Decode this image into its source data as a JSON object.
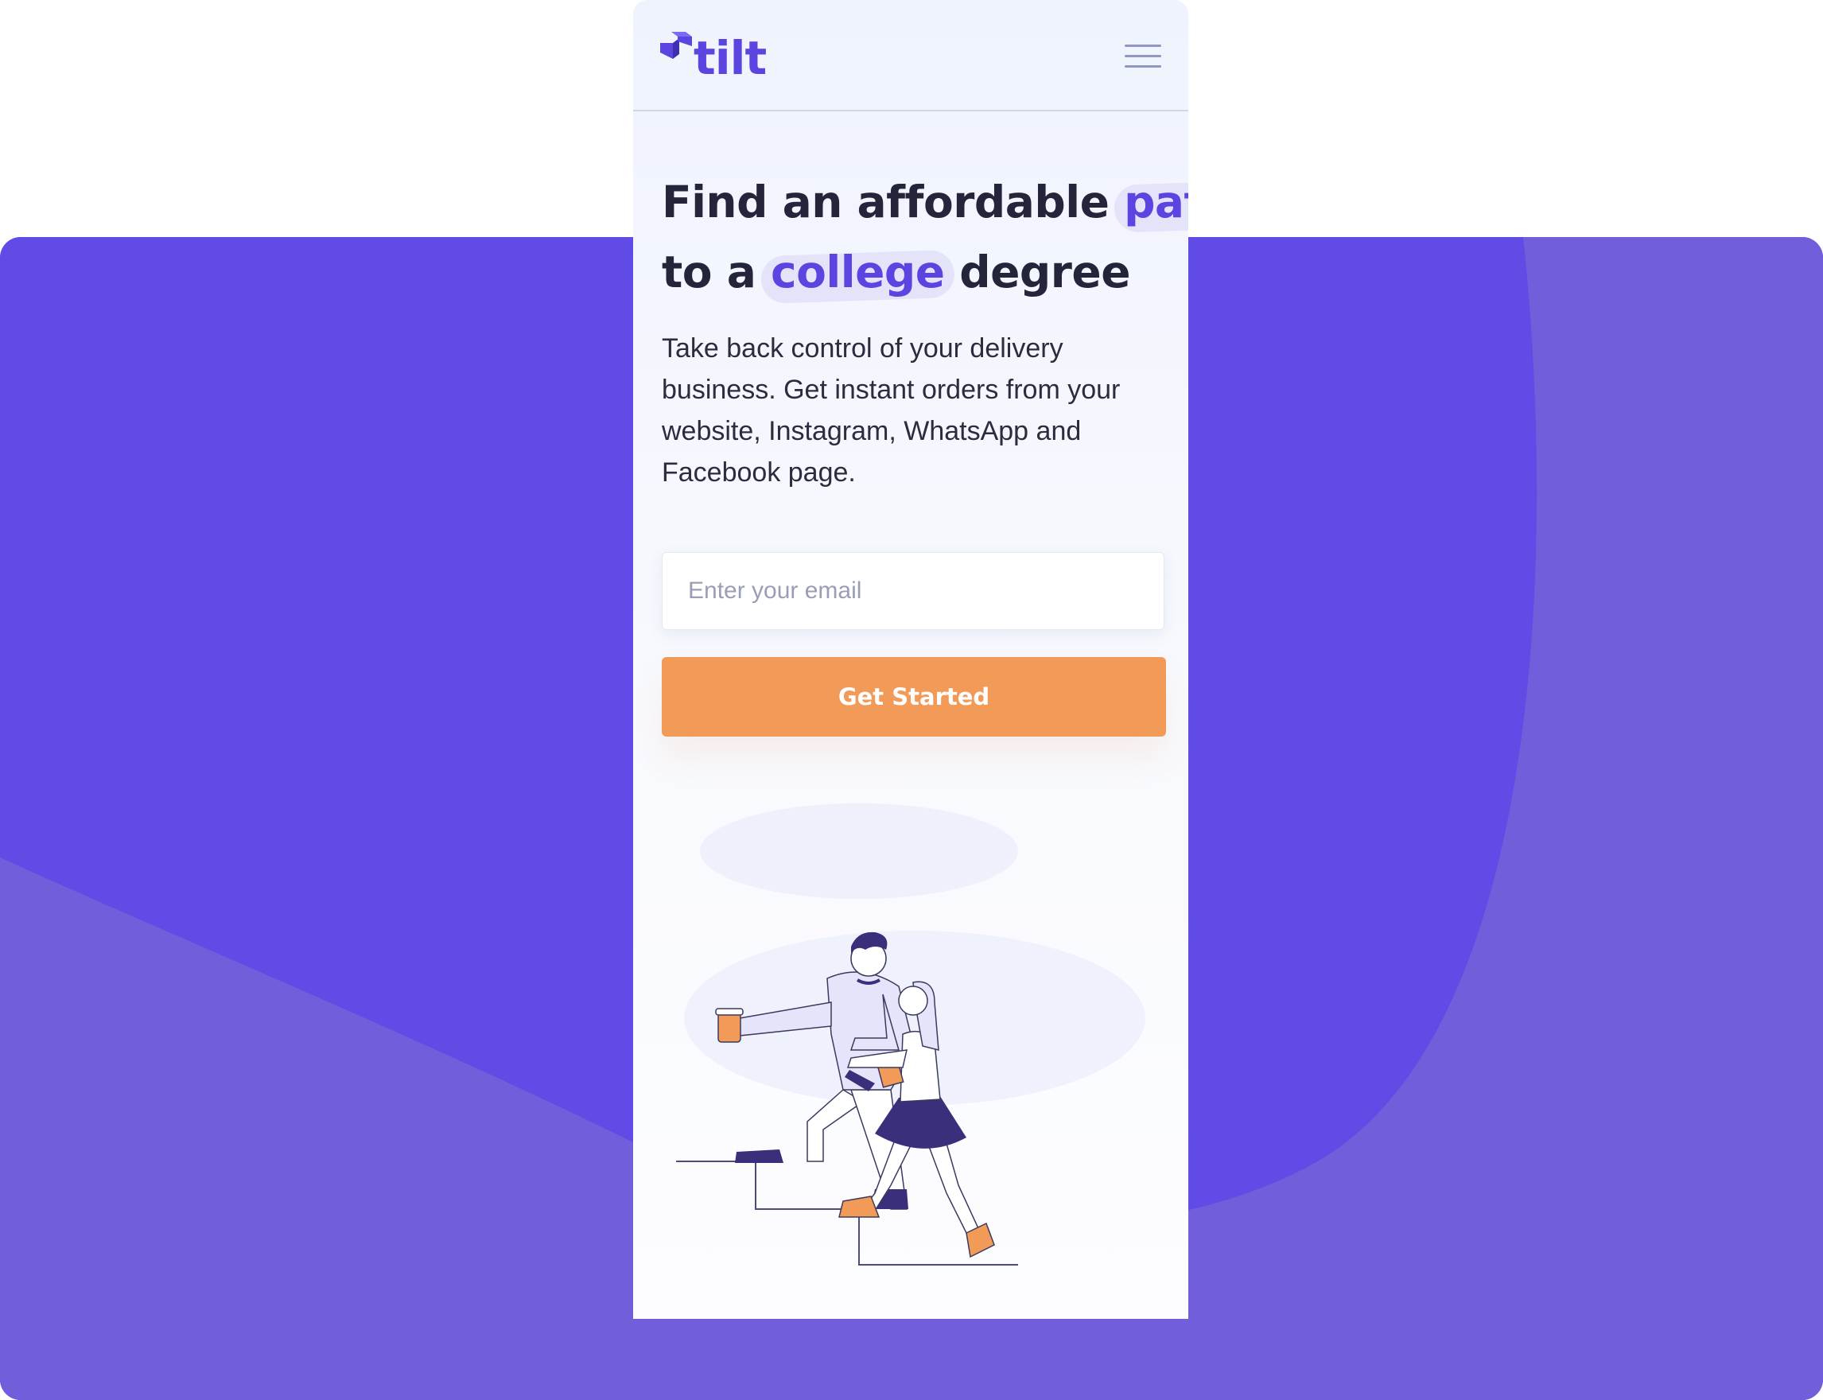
{
  "brand": {
    "name": "tilt",
    "color": "#5b44e0",
    "logo_icon": "stacked-cubes-logo-icon"
  },
  "header": {
    "menu_icon": "hamburger-menu-icon"
  },
  "hero": {
    "headline_part1": "Find an affordable",
    "headline_highlight1": "path",
    "headline_part2": "to a",
    "headline_highlight2": "college",
    "headline_part3": "degree",
    "description": "Take back control of your delivery business. Get instant orders from your website, Instagram, WhatsApp and Facebook page."
  },
  "signup": {
    "email_placeholder": "Enter your email",
    "email_value": "",
    "cta_label": "Get Started"
  },
  "colors": {
    "background_purple": "#614be6",
    "background_purple_light": "#705edb",
    "accent_orange": "#f29a58",
    "text_dark": "#24253a"
  },
  "illustration": {
    "icon": "people-climbing-stairs-illustration"
  }
}
